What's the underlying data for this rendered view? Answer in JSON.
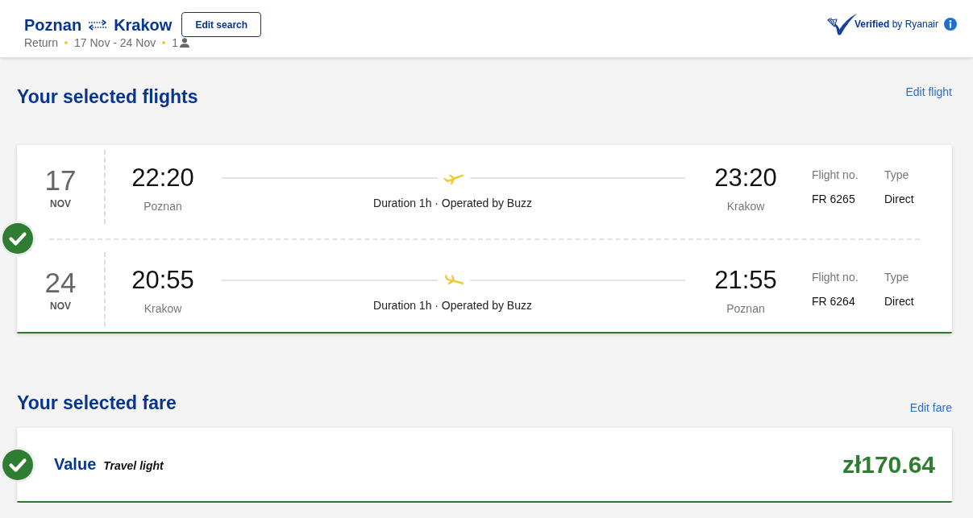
{
  "header": {
    "origin": "Poznan",
    "destination": "Krakow",
    "edit_button": "Edit search",
    "trip_type": "Return",
    "dates": "17 Nov - 24 Nov",
    "passengers": "1",
    "verified_text": "**Verified** by Ryanair"
  },
  "sections": [
    {
      "kind": "flights",
      "title": "Your selected flights",
      "edit_link": "Edit flight",
      "confirmed": true,
      "flights": [
        {
          "kind": "outbound",
          "day": "17",
          "month": "NOV",
          "departure_time": "22:20",
          "departure_city": "Poznan",
          "duration": "Duration 1h · Operated by Buzz",
          "arrival_time": "23:20",
          "arrival_city": "Krakow",
          "flight_no_label": "Flight no.",
          "flight_no": "FR 6265",
          "type_label": "Type",
          "type": "Direct"
        },
        {
          "kind": "inbound",
          "day": "24",
          "month": "NOV",
          "departure_time": "20:55",
          "departure_city": "Krakow",
          "duration": "Duration 1h · Operated by Buzz",
          "arrival_time": "21:55",
          "arrival_city": "Poznan",
          "flight_no_label": "Flight no.",
          "flight_no": "FR 6264",
          "type_label": "Type",
          "type": "Direct"
        }
      ]
    },
    {
      "kind": "fare",
      "title": "Your selected fare",
      "edit_link": "Edit fare",
      "confirmed": true,
      "fare": {
        "name": "Value",
        "description": "Travel light",
        "price": "zł170.64"
      }
    }
  ]
}
